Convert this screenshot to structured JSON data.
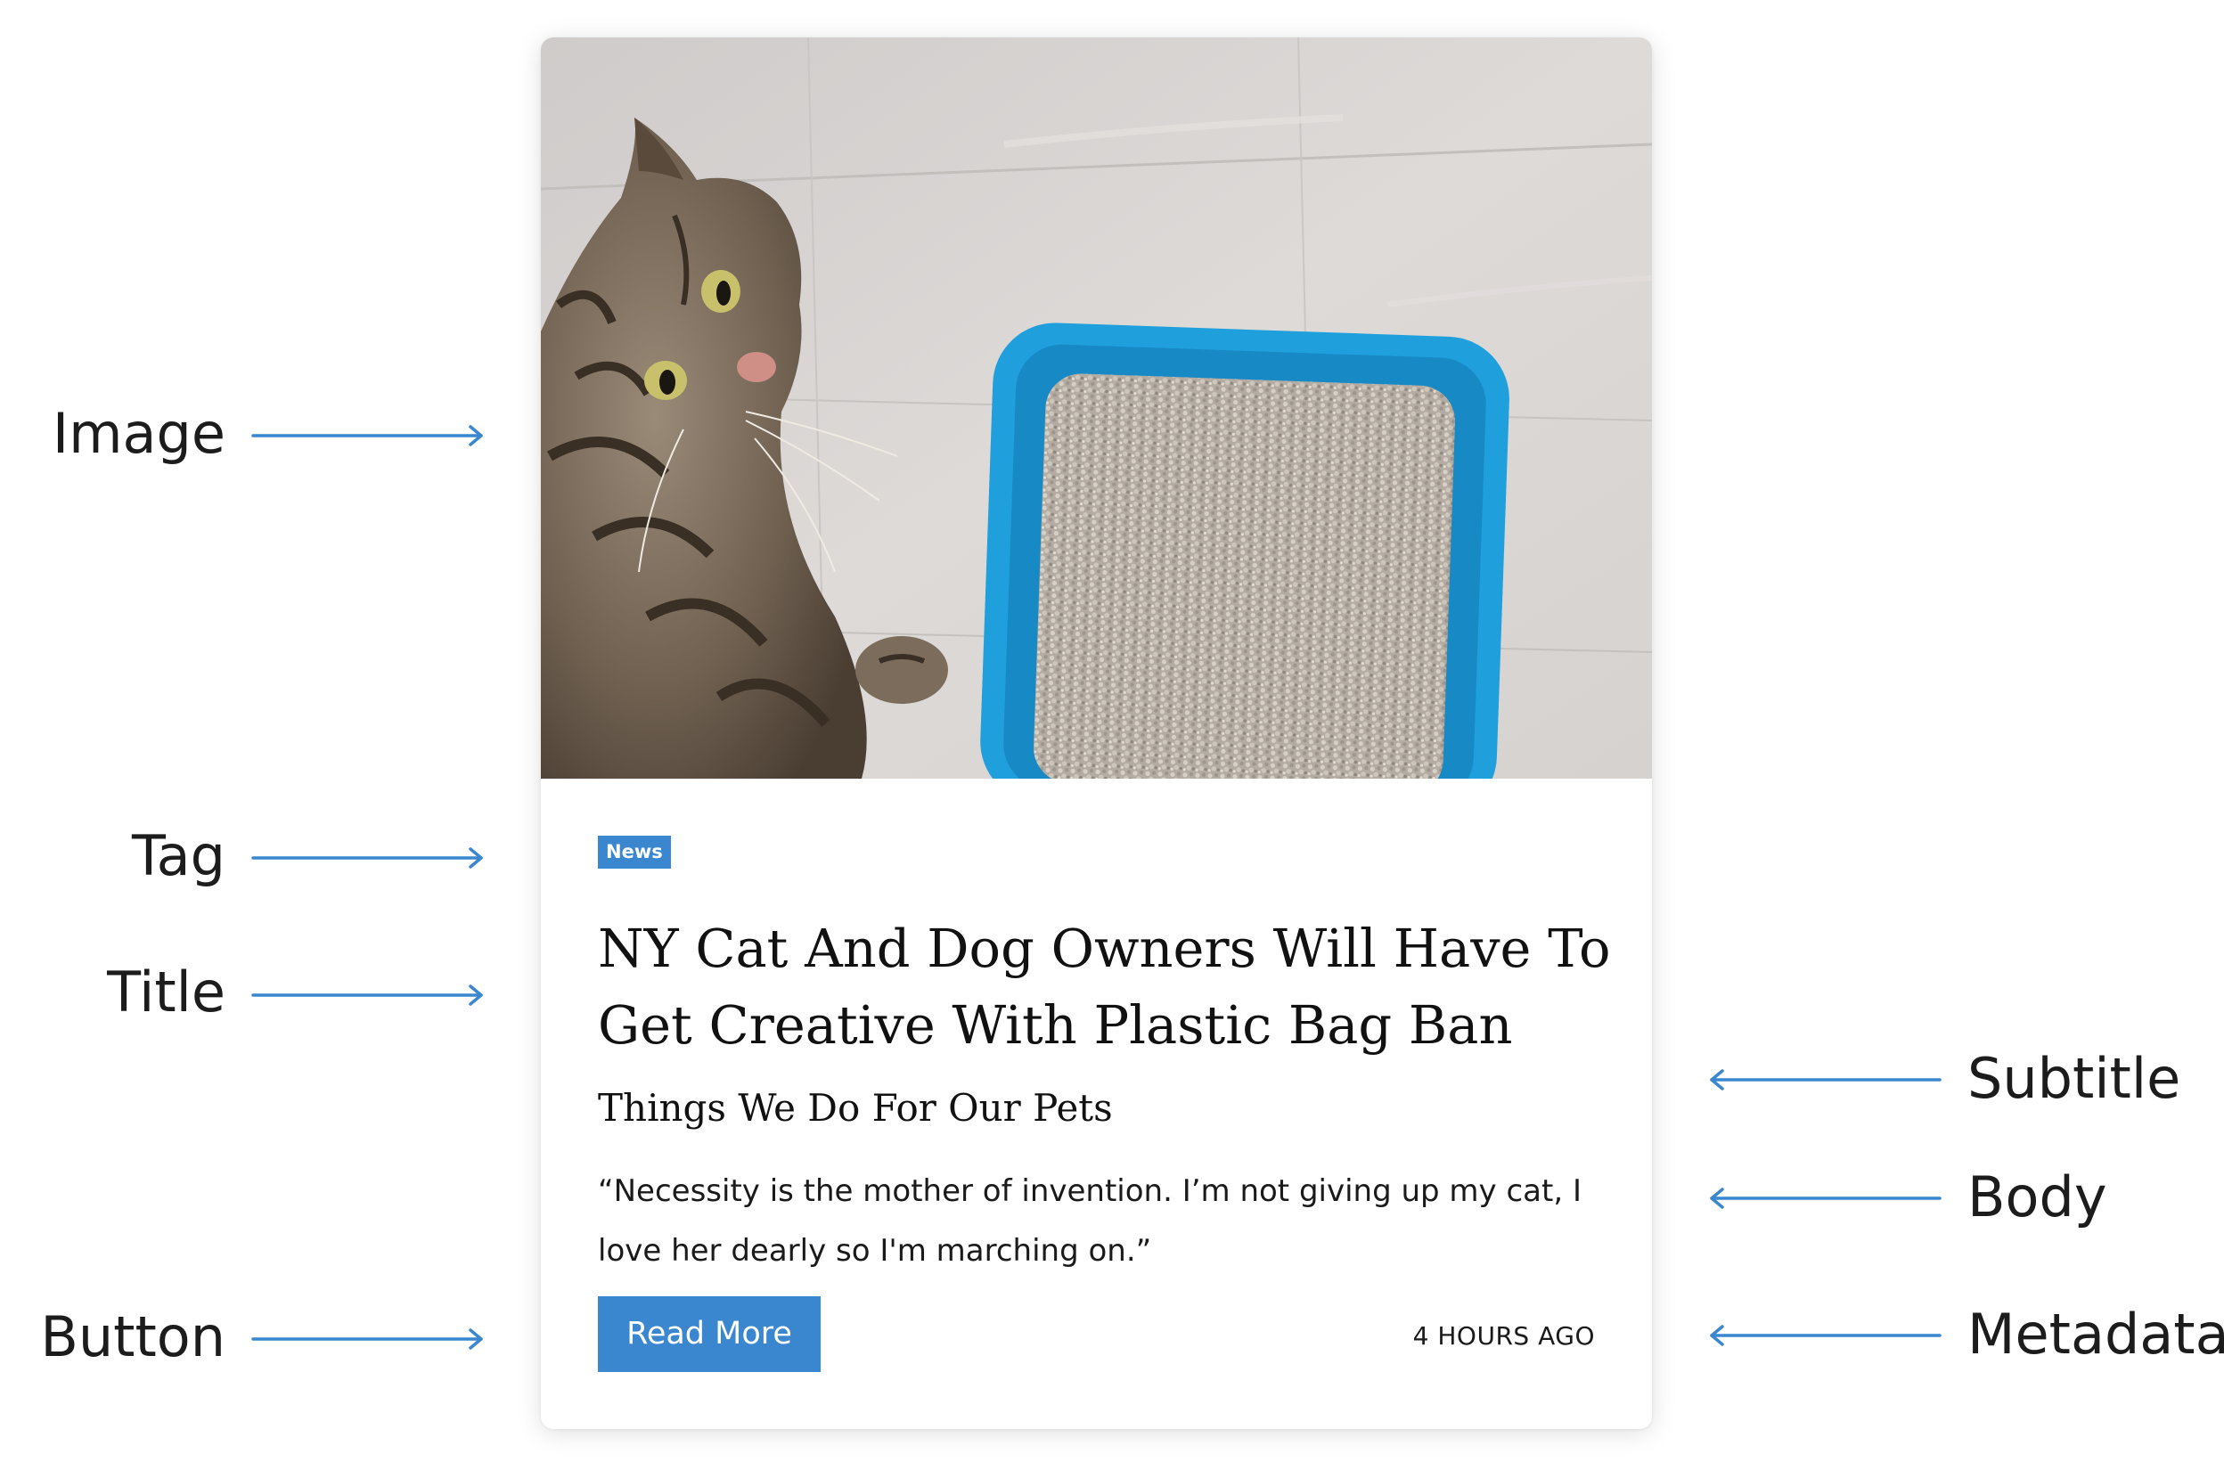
{
  "annotations": {
    "left": [
      "Image",
      "Tag",
      "Title",
      "Button"
    ],
    "right": [
      "Subtitle",
      "Body",
      "Metadata"
    ]
  },
  "card": {
    "image_alt": "Tabby cat looking up next to a blue litter box",
    "tag": "News",
    "title": "NY Cat And Dog Owners Will Have To Get Creative With Plastic Bag Ban",
    "subtitle": "Things We Do For Our Pets",
    "body": "“Necessity is the mother of invention. I’m not giving up my cat, I love her dearly so I'm marching on.”",
    "button_label": "Read More",
    "metadata": "4 HOURS AGO"
  },
  "colors": {
    "accent": "#3a87d0",
    "text": "#111111",
    "card_background": "#ffffff",
    "litter_box": "#1f9fdc"
  }
}
